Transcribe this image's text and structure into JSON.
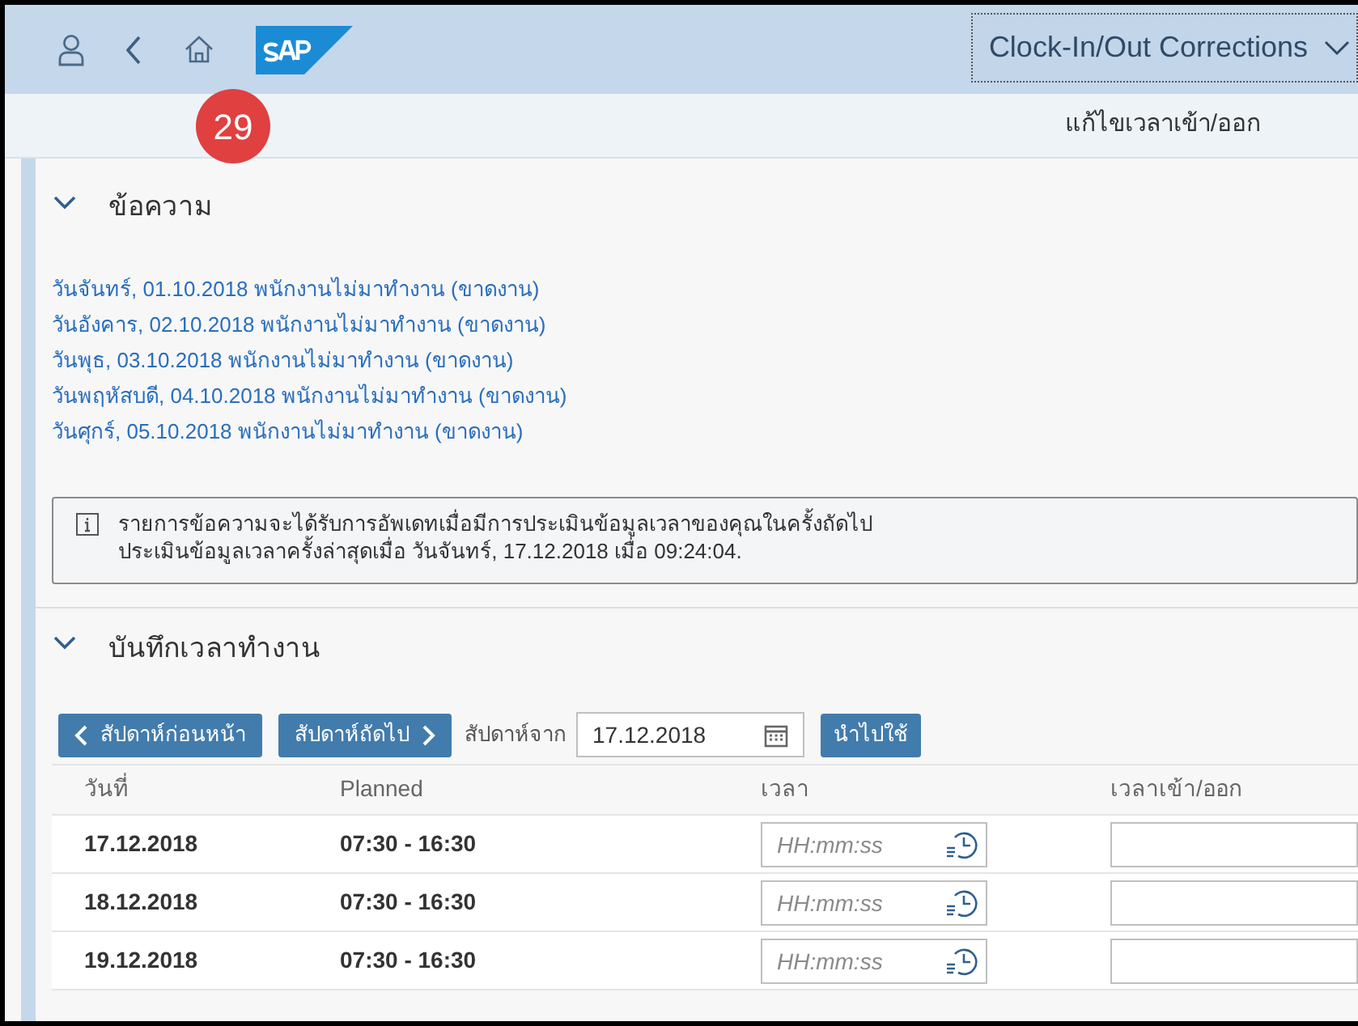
{
  "shell": {
    "app_title": "Clock-In/Out Corrections",
    "page_title": "แก้ไขเวลาเข้า/ออก",
    "badge": "29"
  },
  "messages": {
    "title": "ข้อความ",
    "expanded": true,
    "items": [
      "วันจันทร์, 01.10.2018 พนักงานไม่มาทำงาน (ขาดงาน)",
      "วันอังคาร, 02.10.2018 พนักงานไม่มาทำงาน (ขาดงาน)",
      "วันพุธ, 03.10.2018 พนักงานไม่มาทำงาน (ขาดงาน)",
      "วันพฤหัสบดี, 04.10.2018 พนักงานไม่มาทำงาน (ขาดงาน)",
      "วันศุกร์, 05.10.2018 พนักงานไม่มาทำงาน (ขาดงาน)"
    ],
    "info": [
      "รายการข้อความจะได้รับการอัพเดทเมื่อมีการประเมินข้อมูลเวลาของคุณในครั้งถัดไป",
      "ประเมินข้อมูลเวลาครั้งล่าสุดเมื่อ วันจันทร์, 17.12.2018 เมื่อ 09:24:04."
    ]
  },
  "time_recording": {
    "title": "บันทึกเวลาทำงาน",
    "expanded": true,
    "toolbar": {
      "previous": "สัปดาห์ก่อนหน้า",
      "next": "สัปดาห์ถัดไป",
      "from_label": "สัปดาห์จาก",
      "date": "17.12.2018",
      "apply": "นำไปใช้"
    },
    "columns": [
      "วันที่",
      "Planned",
      "เวลา",
      "เวลาเข้า/ออก"
    ],
    "rows": [
      {
        "date": "17.12.2018",
        "planned": "07:30 - 16:30",
        "time_placeholder": "HH:mm:ss"
      },
      {
        "date": "18.12.2018",
        "planned": "07:30 - 16:30",
        "time_placeholder": "HH:mm:ss"
      },
      {
        "date": "19.12.2018",
        "planned": "07:30 - 16:30",
        "time_placeholder": "HH:mm:ss"
      }
    ]
  }
}
